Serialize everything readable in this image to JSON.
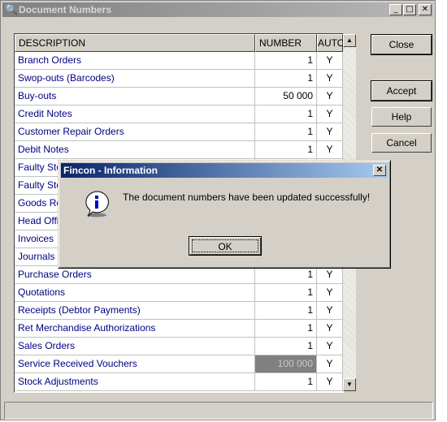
{
  "window": {
    "title": "Document Numbers",
    "buttons": {
      "minimize": "_",
      "maximize": "□",
      "close": "✕"
    }
  },
  "grid": {
    "columns": {
      "description": "DESCRIPTION",
      "number": "NUMBER",
      "auto": "AUTO"
    },
    "rows": [
      {
        "description": "Branch Orders",
        "number": "1",
        "auto": "Y"
      },
      {
        "description": "Swop-outs (Barcodes)",
        "number": "1",
        "auto": "Y"
      },
      {
        "description": "Buy-outs",
        "number": "50 000",
        "auto": "Y"
      },
      {
        "description": "Credit Notes",
        "number": "1",
        "auto": "Y"
      },
      {
        "description": "Customer Repair Orders",
        "number": "1",
        "auto": "Y"
      },
      {
        "description": "Debit Notes",
        "number": "1",
        "auto": "Y"
      },
      {
        "description": "Faulty Sto",
        "number": "",
        "auto": ""
      },
      {
        "description": "Faulty Sto",
        "number": "",
        "auto": ""
      },
      {
        "description": "Goods Re",
        "number": "",
        "auto": ""
      },
      {
        "description": "Head Offic",
        "number": "",
        "auto": ""
      },
      {
        "description": "Invoices",
        "number": "",
        "auto": ""
      },
      {
        "description": "Journals",
        "number": "",
        "auto": ""
      },
      {
        "description": "Purchase Orders",
        "number": "1",
        "auto": "Y"
      },
      {
        "description": "Quotations",
        "number": "1",
        "auto": "Y"
      },
      {
        "description": "Receipts (Debtor Payments)",
        "number": "1",
        "auto": "Y"
      },
      {
        "description": "Ret Merchandise Authorizations",
        "number": "1",
        "auto": "Y"
      },
      {
        "description": "Sales Orders",
        "number": "1",
        "auto": "Y"
      },
      {
        "description": "Service Received Vouchers",
        "number": "100 000",
        "auto": "Y"
      },
      {
        "description": "Stock Adjustments",
        "number": "1",
        "auto": "Y"
      }
    ],
    "scroll_up": "▲",
    "scroll_down": "▼"
  },
  "buttons": {
    "close": "Close",
    "accept": "Accept",
    "help": "Help",
    "cancel": "Cancel"
  },
  "dialog": {
    "title": "Fincon - Information",
    "close": "✕",
    "message": "The document numbers have been updated successfully!",
    "ok": "OK"
  },
  "colors": {
    "dialog_title": "#0a246a",
    "window_title_inactive": "#808080",
    "row_text": "#000080",
    "selected_cell": "#808080"
  }
}
